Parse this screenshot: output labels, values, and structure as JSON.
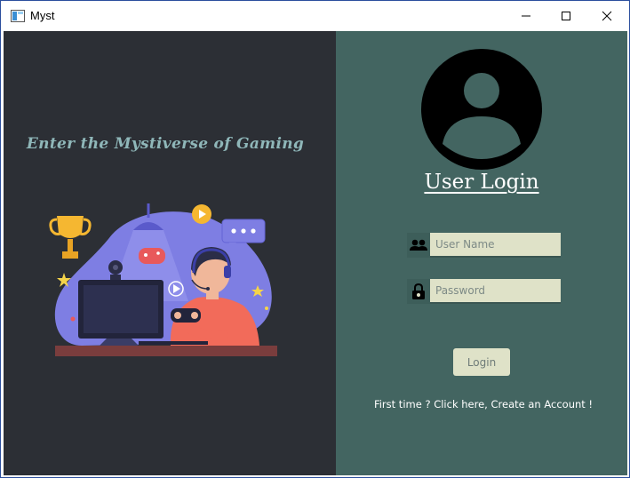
{
  "window": {
    "title": "Myst"
  },
  "left": {
    "tagline": "Enter the Mystiverse of Gaming"
  },
  "login": {
    "heading": "User Login",
    "username_placeholder": "User Name",
    "password_placeholder": "Password",
    "button_label": "Login",
    "create_account_text": "First time ? Click here, Create an Account !"
  },
  "colors": {
    "left_panel_bg": "#2c2f35",
    "right_panel_bg": "#436561",
    "input_bg": "#dfe2c8",
    "tagline": "#8fb7b9"
  }
}
